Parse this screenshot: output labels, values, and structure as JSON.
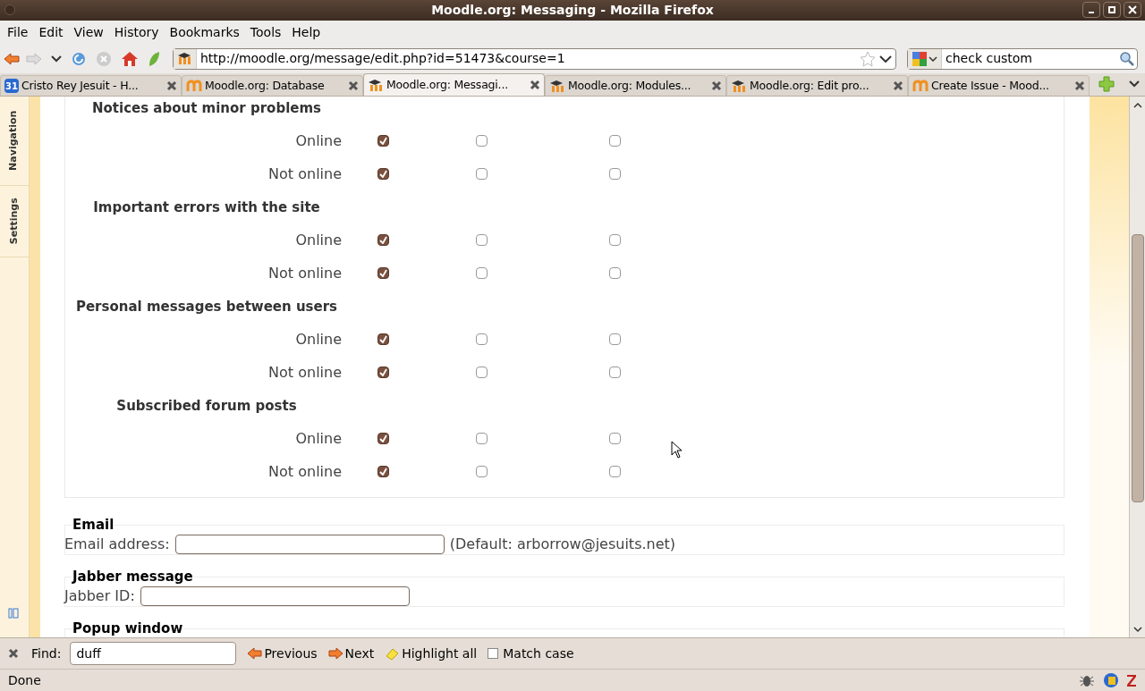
{
  "window": {
    "title": "Moodle.org: Messaging - Mozilla Firefox"
  },
  "menu": [
    {
      "label": "File"
    },
    {
      "label": "Edit"
    },
    {
      "label": "View"
    },
    {
      "label": "History"
    },
    {
      "label": "Bookmarks"
    },
    {
      "label": "Tools"
    },
    {
      "label": "Help"
    }
  ],
  "address": {
    "value": "http://moodle.org/message/edit.php?id=51473&course=1"
  },
  "search": {
    "value": "check custom"
  },
  "tabs": [
    {
      "label": "Cristo Rey Jesuit - H...",
      "kind": "calendar",
      "icon_text": "31",
      "selected": false
    },
    {
      "label": "Moodle.org: Database",
      "kind": "m",
      "selected": false
    },
    {
      "label": "Moodle.org: Messagi...",
      "kind": "cap",
      "selected": true
    },
    {
      "label": "Moodle.org: Modules...",
      "kind": "cap",
      "selected": false
    },
    {
      "label": "Moodle.org: Edit pro...",
      "kind": "cap",
      "selected": false
    },
    {
      "label": "Create Issue - Mood...",
      "kind": "m",
      "selected": false
    }
  ],
  "side_tabs": [
    "Navigation",
    "Settings"
  ],
  "sections": [
    {
      "title": "Notices about minor problems",
      "rows": [
        {
          "label": "Online",
          "checks": [
            true,
            false,
            false
          ]
        },
        {
          "label": "Not online",
          "checks": [
            true,
            false,
            false
          ]
        }
      ]
    },
    {
      "title": "Important errors with the site",
      "rows": [
        {
          "label": "Online",
          "checks": [
            true,
            false,
            false
          ]
        },
        {
          "label": "Not online",
          "checks": [
            true,
            false,
            false
          ]
        }
      ]
    },
    {
      "title": "Personal messages between users",
      "rows": [
        {
          "label": "Online",
          "checks": [
            true,
            false,
            false
          ]
        },
        {
          "label": "Not online",
          "checks": [
            true,
            false,
            false
          ]
        }
      ]
    },
    {
      "title": "Subscribed forum posts",
      "rows": [
        {
          "label": "Online",
          "checks": [
            true,
            false,
            false
          ]
        },
        {
          "label": "Not online",
          "checks": [
            true,
            false,
            false
          ]
        }
      ]
    }
  ],
  "fieldsets": [
    {
      "legend": "Email",
      "label": "Email address:",
      "note": "(Default: arborrow@jesuits.net)"
    },
    {
      "legend": "Jabber message",
      "label": "Jabber ID:"
    },
    {
      "legend": "Popup window"
    }
  ],
  "find_bar": {
    "label": "Find:",
    "value": "duff",
    "buttons": [
      {
        "label": "Previous",
        "kind": "prev"
      },
      {
        "label": "Next",
        "kind": "next"
      },
      {
        "label": "Highlight all",
        "kind": "highlight"
      }
    ],
    "match_case": {
      "label": "Match case",
      "checked": false
    }
  },
  "status_bar": {
    "text": "Done"
  }
}
